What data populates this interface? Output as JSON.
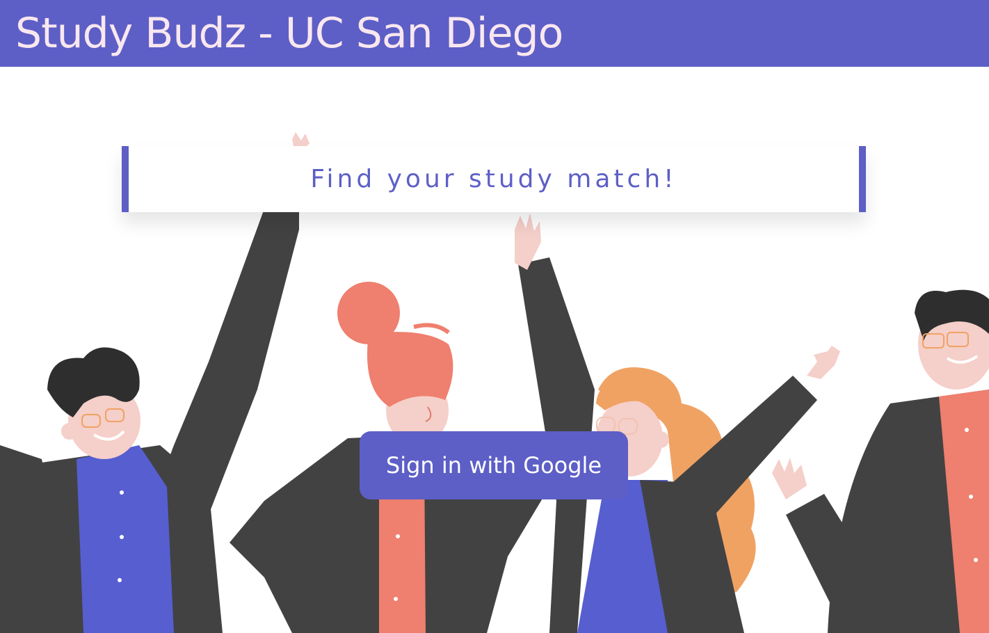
{
  "header": {
    "title": "Study Budz - UC San Diego"
  },
  "hero": {
    "tagline": "Find your study match!"
  },
  "auth": {
    "signin_label": "Sign in with Google"
  },
  "colors": {
    "header_bg": "#5d5fc6",
    "header_text": "#f9e7ef",
    "accent": "#5d5fc6",
    "jacket": "#424242",
    "coral": "#ef7f6e",
    "blue_shirt": "#565ed0",
    "skin": "#f5cfc9",
    "orange_hair": "#f0a263"
  },
  "illustration": {
    "subject": "group of cheering students"
  }
}
